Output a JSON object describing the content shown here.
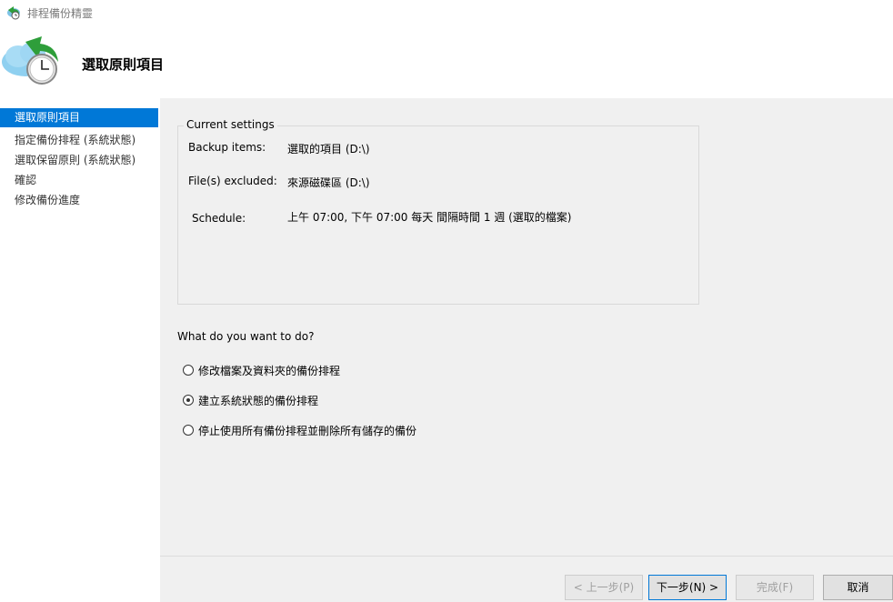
{
  "window": {
    "title": "排程備份精靈"
  },
  "header": {
    "title": "選取原則項目"
  },
  "sidebar": {
    "items": [
      {
        "label": "選取原則項目",
        "active": true
      },
      {
        "label": "指定備份排程 (系統狀態)",
        "active": false
      },
      {
        "label": "選取保留原則 (系統狀態)",
        "active": false
      },
      {
        "label": "確認",
        "active": false
      },
      {
        "label": "修改備份進度",
        "active": false
      }
    ]
  },
  "current_settings": {
    "legend": "Current settings",
    "backup_items_label": "Backup items:",
    "backup_items_value": "選取的項目 (D:\\)",
    "excluded_label": "File(s) excluded:",
    "excluded_value": "來源磁碟區 (D:\\)",
    "schedule_label": "Schedule:",
    "schedule_value": "上午 07:00, 下午 07:00 每天 間隔時間 1 週 (選取的檔案)"
  },
  "question": "What do you want to do?",
  "options": [
    {
      "label": "修改檔案及資料夾的備份排程",
      "checked": false
    },
    {
      "label": "建立系統狀態的備份排程",
      "checked": true
    },
    {
      "label": "停止使用所有備份排程並刪除所有儲存的備份",
      "checked": false
    }
  ],
  "buttons": {
    "back": "< 上一步(P)",
    "next": "下一步(N) >",
    "finish": "完成(F)",
    "cancel": "取消"
  },
  "colors": {
    "accent": "#0078d7",
    "panel": "#f0f0f0"
  }
}
